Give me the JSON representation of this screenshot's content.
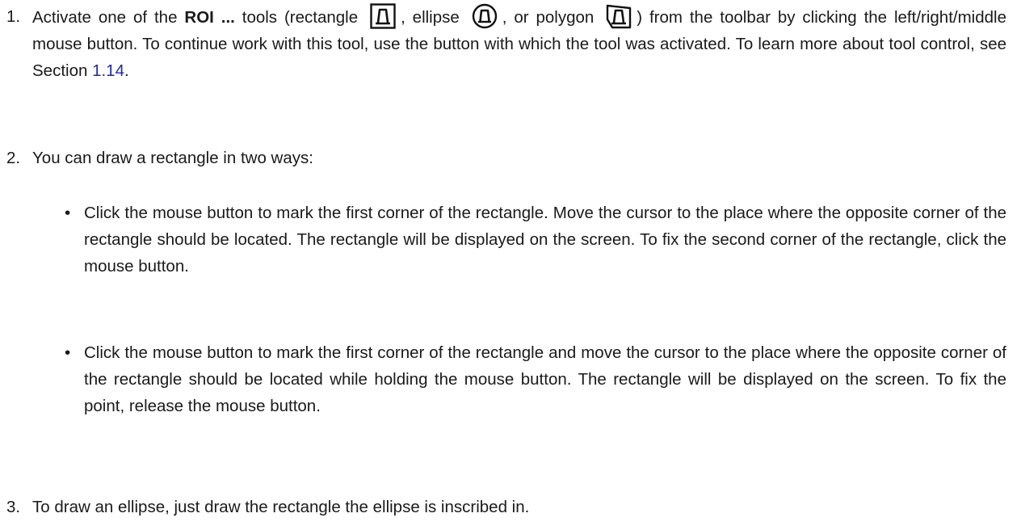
{
  "steps": [
    {
      "number": "1.",
      "text_before_bold": "Activate one of the ",
      "bold": "ROI ...",
      "text_after_bold": " tools (rectangle ",
      "sep_ellipse": ", ellipse ",
      "sep_polygon": ", or polygon ",
      "text_after_icons": ") from the toolbar by clicking the left/right/middle mouse button. To continue work with this tool, use the button with which the tool was activated. To learn more about tool control, see Section ",
      "section_link": "1.14",
      "text_end": "."
    },
    {
      "number": "2.",
      "text": "You can draw a rectangle in two ways:",
      "bullets": [
        "Click the mouse button to mark the first corner of the rectangle. Move the cursor to the place where the opposite corner of the rectangle should be located. The rectangle will be displayed on the screen. To fix the second corner of the rectangle, click the mouse button.",
        "Click the mouse button to mark the first corner of the rectangle and move the cursor to the place where the opposite corner of the rectangle should be located while holding the mouse button. The rectangle will be displayed on the screen. To fix the point, release the mouse button."
      ],
      "bullet_symbol": "•"
    },
    {
      "number": "3.",
      "text": "To draw an ellipse, just draw the rectangle the ellipse is inscribed in."
    }
  ],
  "icons": {
    "rectangle": "roi-rectangle-icon",
    "ellipse": "roi-ellipse-icon",
    "polygon": "roi-polygon-icon"
  }
}
